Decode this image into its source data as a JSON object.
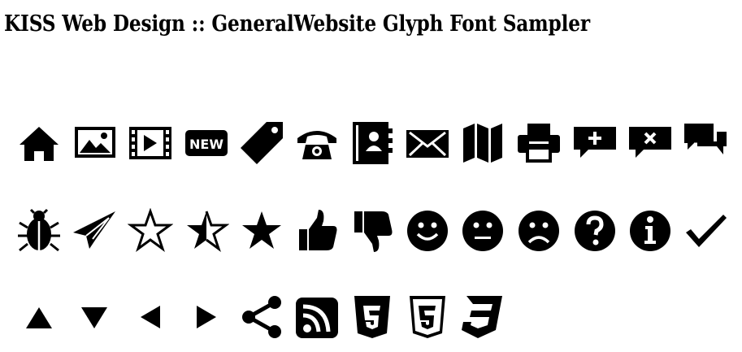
{
  "page": {
    "title": "KISS Web Design :: GeneralWebsite Glyph Font Sampler"
  },
  "rows": [
    [
      "home-icon",
      "image-icon",
      "video-icon",
      "new-badge-icon",
      "tag-icon",
      "phone-icon",
      "address-book-icon",
      "mail-icon",
      "map-icon",
      "printer-icon",
      "comment-add-icon",
      "comment-remove-icon",
      "comments-icon"
    ],
    [
      "bug-icon",
      "paper-plane-icon",
      "star-empty-icon",
      "star-half-icon",
      "star-full-icon",
      "thumbs-up-icon",
      "thumbs-down-icon",
      "smile-icon",
      "neutral-face-icon",
      "frown-icon",
      "question-icon",
      "info-icon",
      "checkmark-icon"
    ],
    [
      "arrow-up-icon",
      "arrow-down-icon",
      "arrow-left-icon",
      "arrow-right-icon",
      "share-icon",
      "rss-icon",
      "html5-icon",
      "html5-outline-icon",
      "css3-icon"
    ]
  ],
  "labels": {
    "new_badge": "NEW"
  }
}
